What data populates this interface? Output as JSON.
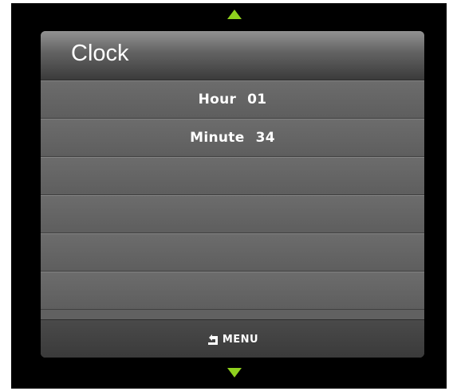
{
  "header": {
    "title": "Clock"
  },
  "menu_items": [
    {
      "label": "Hour",
      "value": "01"
    },
    {
      "label": "Minute",
      "value": "34"
    },
    {
      "label": "",
      "value": ""
    },
    {
      "label": "",
      "value": ""
    },
    {
      "label": "",
      "value": ""
    },
    {
      "label": "",
      "value": ""
    }
  ],
  "footer": {
    "back_label": "MENU",
    "back_icon": "return-arrow-icon"
  },
  "navigation": {
    "up_icon": "arrow-up-icon",
    "down_icon": "arrow-down-icon"
  },
  "colors": {
    "accent": "#8fd11e",
    "panel": "#616161",
    "header": "#5b5b5b",
    "footer": "#3a3a3a"
  }
}
